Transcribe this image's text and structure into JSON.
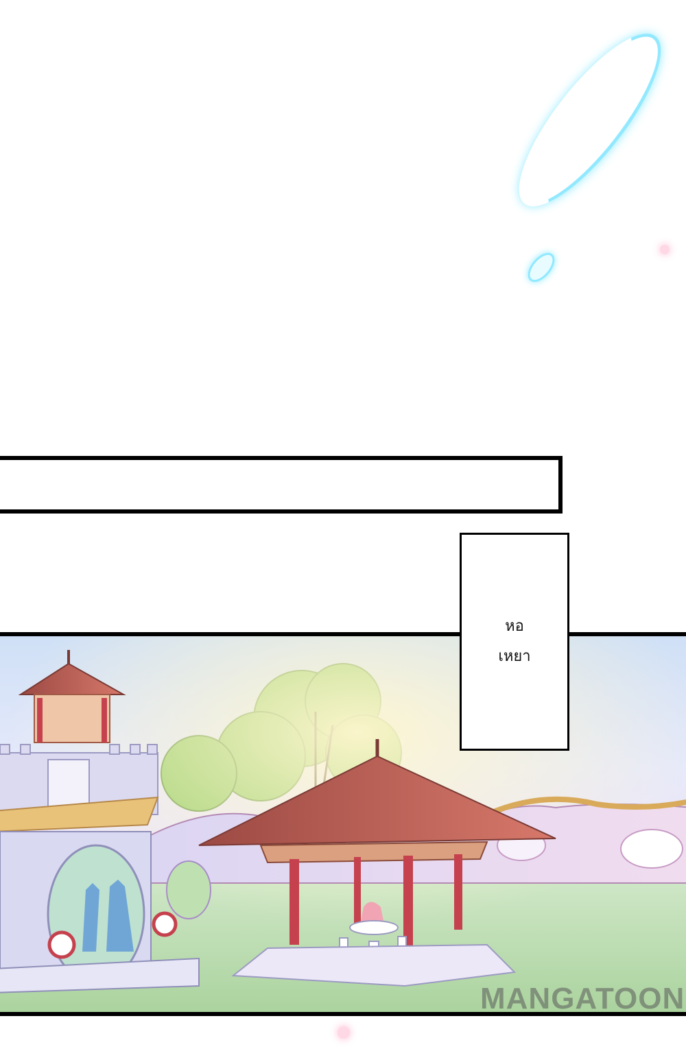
{
  "location_caption": {
    "line1": "หอ",
    "line2": "เหยา"
  },
  "watermark": {
    "text": "MANGATOON"
  },
  "colors": {
    "border": "#000000",
    "light_streak": "#7fe6ff",
    "roof": "#b85a4a",
    "pillar": "#c5414e",
    "tree": "#9ccf6e",
    "wall": "#e3d9f2",
    "grass": "#c3dfb8"
  }
}
